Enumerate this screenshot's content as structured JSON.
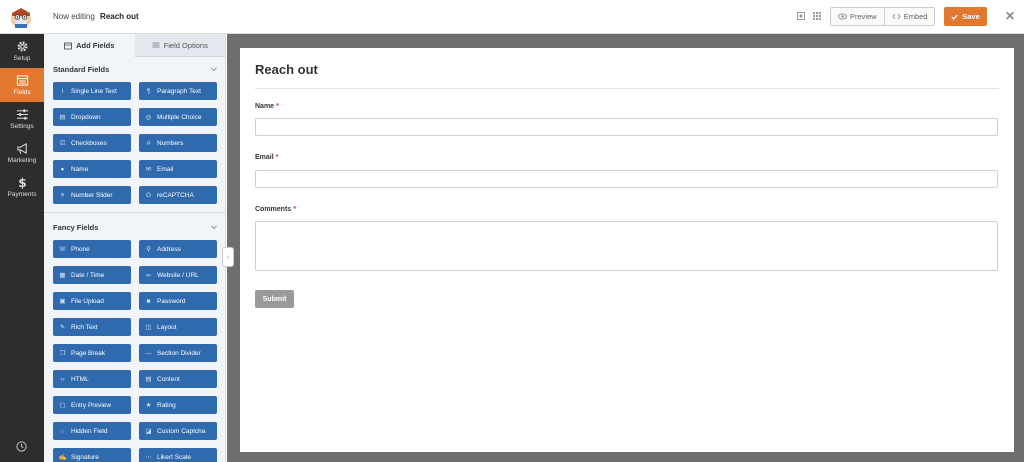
{
  "header": {
    "editing_label": "Now editing",
    "form_name": "Reach out",
    "preview_label": "Preview",
    "embed_label": "Embed",
    "save_label": "Save",
    "accent_color": "#e27730"
  },
  "nav": {
    "items": [
      {
        "label": "Setup",
        "icon": "gear-icon",
        "active": false
      },
      {
        "label": "Fields",
        "icon": "fields-icon",
        "active": true
      },
      {
        "label": "Settings",
        "icon": "sliders-icon",
        "active": false
      },
      {
        "label": "Marketing",
        "icon": "megaphone-icon",
        "active": false
      },
      {
        "label": "Payments",
        "icon": "dollar-icon",
        "active": false
      }
    ]
  },
  "panel": {
    "tabs": [
      {
        "label": "Add Fields",
        "icon": "add-fields-icon",
        "active": true
      },
      {
        "label": "Field Options",
        "icon": "field-options-icon",
        "active": false
      }
    ],
    "standard_title": "Standard Fields",
    "standard_fields": [
      {
        "label": "Single Line Text",
        "icon": "text-cursor-icon"
      },
      {
        "label": "Paragraph Text",
        "icon": "paragraph-icon"
      },
      {
        "label": "Dropdown",
        "icon": "dropdown-icon"
      },
      {
        "label": "Multiple Choice",
        "icon": "radio-icon"
      },
      {
        "label": "Checkboxes",
        "icon": "checkbox-icon"
      },
      {
        "label": "Numbers",
        "icon": "hash-icon"
      },
      {
        "label": "Name",
        "icon": "user-icon"
      },
      {
        "label": "Email",
        "icon": "envelope-icon"
      },
      {
        "label": "Number Slider",
        "icon": "slider-icon"
      },
      {
        "label": "reCAPTCHA",
        "icon": "google-icon"
      }
    ],
    "fancy_title": "Fancy Fields",
    "fancy_fields": [
      {
        "label": "Phone",
        "icon": "phone-icon"
      },
      {
        "label": "Address",
        "icon": "map-marker-icon"
      },
      {
        "label": "Date / Time",
        "icon": "calendar-icon"
      },
      {
        "label": "Website / URL",
        "icon": "link-icon"
      },
      {
        "label": "File Upload",
        "icon": "upload-icon"
      },
      {
        "label": "Password",
        "icon": "lock-icon"
      },
      {
        "label": "Rich Text",
        "icon": "edit-icon"
      },
      {
        "label": "Layout",
        "icon": "columns-icon"
      },
      {
        "label": "Page Break",
        "icon": "copy-icon"
      },
      {
        "label": "Section Divider",
        "icon": "divider-icon"
      },
      {
        "label": "HTML",
        "icon": "code-icon"
      },
      {
        "label": "Content",
        "icon": "content-icon"
      },
      {
        "label": "Entry Preview",
        "icon": "preview-icon"
      },
      {
        "label": "Rating",
        "icon": "star-icon"
      },
      {
        "label": "Hidden Field",
        "icon": "eye-slash-icon"
      },
      {
        "label": "Custom Captcha",
        "icon": "captcha-icon"
      },
      {
        "label": "Signature",
        "icon": "signature-icon"
      },
      {
        "label": "Likert Scale",
        "icon": "likert-icon"
      }
    ]
  },
  "form": {
    "title": "Reach out",
    "fields": [
      {
        "label": "Name",
        "required_mark": "*"
      },
      {
        "label": "Email",
        "required_mark": "*"
      },
      {
        "label": "Comments",
        "required_mark": "*"
      }
    ],
    "submit_label": "Submit"
  }
}
